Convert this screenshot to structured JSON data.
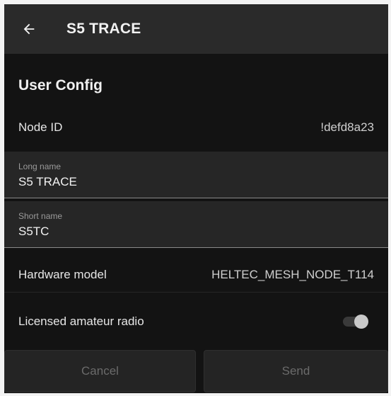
{
  "header": {
    "title": "S5 TRACE",
    "back_icon": "arrow-left-icon"
  },
  "section": {
    "title": "User Config"
  },
  "node_id": {
    "label": "Node ID",
    "value": "!defd8a23"
  },
  "long_name": {
    "label": "Long name",
    "value": "S5 TRACE"
  },
  "short_name": {
    "label": "Short name",
    "value": "S5TC"
  },
  "hardware_model": {
    "label": "Hardware model",
    "value": "HELTEC_MESH_NODE_T114"
  },
  "licensed_amateur_radio": {
    "label": "Licensed amateur radio",
    "enabled": false
  },
  "actions": {
    "cancel_label": "Cancel",
    "send_label": "Send"
  },
  "colors": {
    "background": "#131313",
    "topbar": "#2a2a2a",
    "field_bg": "#262626",
    "text": "#f2f2f2",
    "disabled_text": "#6b6b6b"
  }
}
